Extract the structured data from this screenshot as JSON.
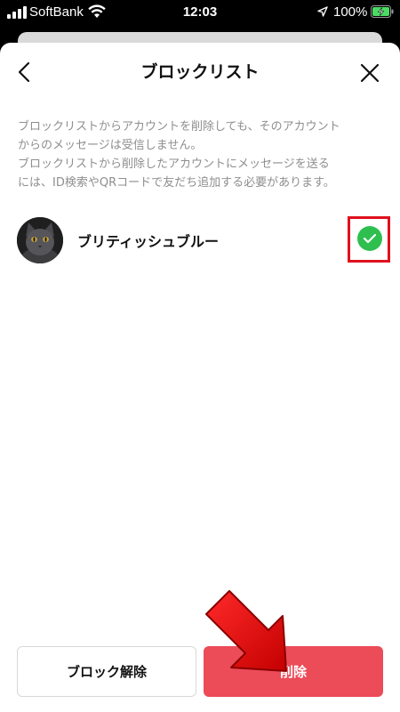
{
  "status_bar": {
    "carrier": "SoftBank",
    "time": "12:03",
    "battery_percent": "100%",
    "icons": [
      "signal-icon",
      "wifi-icon",
      "location-arrow-icon",
      "battery-charging-icon"
    ]
  },
  "header": {
    "title": "ブロックリスト",
    "back_icon": "chevron-left-icon",
    "close_icon": "close-icon"
  },
  "description": {
    "line1": "ブロックリストからアカウントを削除しても、そのアカウント",
    "line2": "からのメッセージは受信しません。",
    "line3": "ブロックリストから削除したアカウントにメッセージを送る",
    "line4": "には、ID検索やQRコードで友だち追加する必要があります。"
  },
  "blocked_list": [
    {
      "name": "ブリティッシュブルー",
      "avatar": "cat-avatar",
      "selected": true
    }
  ],
  "footer": {
    "unblock_label": "ブロック解除",
    "delete_label": "削除"
  },
  "colors": {
    "accent_delete": "#ec4b58",
    "check_green": "#2fbf4f",
    "highlight_red": "#e0101c",
    "description_gray": "#8e8e8e"
  }
}
